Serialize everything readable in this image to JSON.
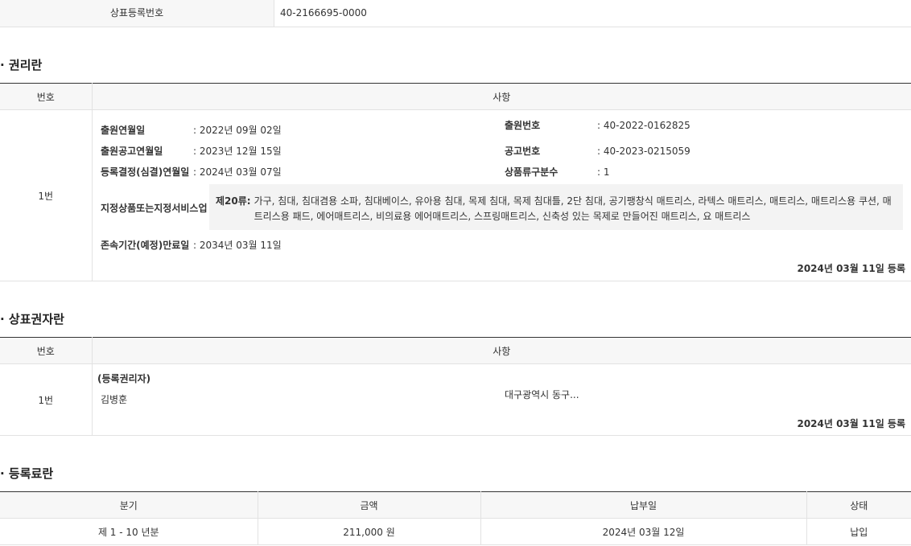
{
  "top_row": {
    "label": "상표등록번호",
    "value": "40-2166695-0000"
  },
  "rights": {
    "title": "권리란",
    "headers": {
      "no": "번호",
      "item": "사항"
    },
    "row_no": "1번",
    "fields_left": [
      {
        "k": "출원연월일",
        "v": ": 2022년 09월 02일"
      },
      {
        "k": "출원공고연월일",
        "v": ": 2023년 12월 15일"
      },
      {
        "k": "등록결정(심결)연월일",
        "v": ": 2024년 03월 07일"
      }
    ],
    "fields_right": [
      {
        "k": "출원번호",
        "v": ": 40-2022-0162825"
      },
      {
        "k": "공고번호",
        "v": ": 40-2023-0215059"
      },
      {
        "k": "상품류구분수",
        "v": ": 1"
      }
    ],
    "goods_label": "지정상품또는지정서비스업",
    "goods_class": "제20류:",
    "goods_desc": "가구, 침대, 침대겸용 소파, 침대베이스, 유아용 침대, 목제 침대, 목제 침대틀, 2단 침대, 공기팽창식 매트리스, 라텍스 매트리스, 매트리스, 매트리스용 쿠션, 매트리스용 패드, 에어매트리스, 비의료용 에어매트리스, 스프링매트리스, 신축성 있는 목제로 만들어진 매트리스, 요 매트리스",
    "expiry_label": "존속기간(예정)만료일",
    "expiry_value": ": 2034년 03월 11일",
    "reg_date": "2024년 03월 11일 등록"
  },
  "holder": {
    "title": "상표권자란",
    "headers": {
      "no": "번호",
      "item": "사항"
    },
    "row_no": "1번",
    "role": "(등록권리자)",
    "name": "김병훈",
    "address": "대구광역시 동구...",
    "reg_date": "2024년 03월 11일 등록"
  },
  "fees": {
    "title": "등록료란",
    "headers": [
      "분기",
      "금액",
      "납부일",
      "상태"
    ],
    "rows": [
      [
        "제 1 - 10 년분",
        "211,000 원",
        "2024년 03월 12일",
        "납입"
      ]
    ]
  }
}
